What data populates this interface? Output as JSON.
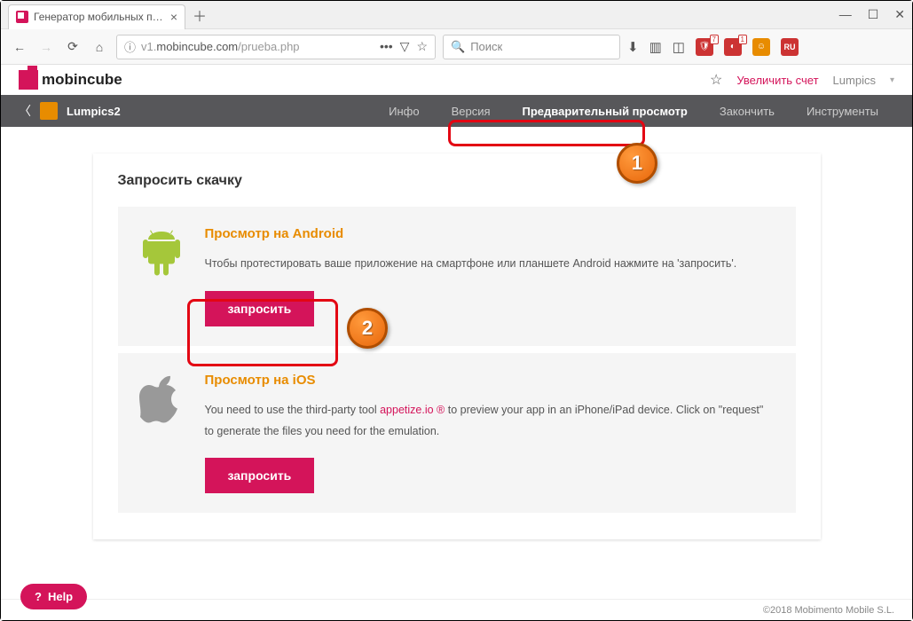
{
  "browser": {
    "tab_title": "Генератор мобильных прило",
    "url_prefix": "v1.",
    "url_domain": "mobincube.com",
    "url_path": "/prueba.php",
    "search_placeholder": "Поиск",
    "ext_badge_1": "7",
    "ext_badge_2": "1",
    "ru": "RU"
  },
  "header": {
    "logo": "mobincube",
    "upgrade": "Увеличить счет",
    "user": "Lumpics"
  },
  "subnav": {
    "app_name": "Lumpics2",
    "items": [
      "Инфо",
      "Версия",
      "Предварительный просмотр",
      "Закончить",
      "Инструменты"
    ],
    "active_index": 2
  },
  "card": {
    "title": "Запросить скачку",
    "android": {
      "title": "Просмотр на Android",
      "text": "Чтобы протестировать ваше приложение на смартфоне или планшете Android нажмите на 'запросить'.",
      "button": "запросить"
    },
    "ios": {
      "title": "Просмотр на iOS",
      "text_pre": "You need to use the third-party tool ",
      "text_link": "appetize.io ®",
      "text_post": " to preview your app in an iPhone/iPad device. Click on \"request\" to generate the files you need for the emulation.",
      "button": "запросить"
    }
  },
  "badges": {
    "b1": "1",
    "b2": "2"
  },
  "help": "Help",
  "footer": "©2018 Mobimento Mobile S.L."
}
